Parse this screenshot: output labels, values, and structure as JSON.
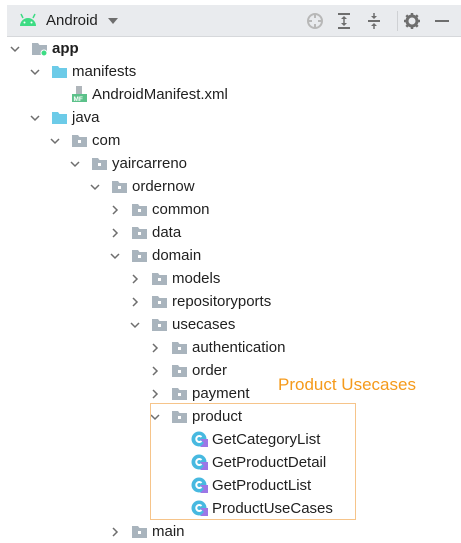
{
  "toolbar": {
    "view_mode": "Android",
    "icons": [
      "android-icon",
      "dropdown-caret-icon",
      "locate-icon",
      "expand-all-icon",
      "collapse-all-icon",
      "settings-gear-icon",
      "hide-minus-icon"
    ]
  },
  "colors": {
    "folder": "#a9b4bd",
    "source_folder": "#6ccbe8",
    "highlight": "#f59a1b",
    "kotlin_class": "#47b9e0",
    "kotlin_badge": "#9c77e6",
    "android_green": "#3ddc84"
  },
  "tree": [
    {
      "label": "app",
      "level": 0,
      "expanded": true,
      "icon": "module-folder-icon",
      "bold": true
    },
    {
      "label": "manifests",
      "level": 1,
      "expanded": true,
      "icon": "source-folder-icon"
    },
    {
      "label": "AndroidManifest.xml",
      "level": 2,
      "expanded": null,
      "icon": "manifest-file-icon"
    },
    {
      "label": "java",
      "level": 1,
      "expanded": true,
      "icon": "source-folder-icon"
    },
    {
      "label": "com",
      "level": 2,
      "expanded": true,
      "icon": "package-icon"
    },
    {
      "label": "yaircarreno",
      "level": 3,
      "expanded": true,
      "icon": "package-icon"
    },
    {
      "label": "ordernow",
      "level": 4,
      "expanded": true,
      "icon": "package-icon"
    },
    {
      "label": "common",
      "level": 5,
      "expanded": false,
      "icon": "package-icon"
    },
    {
      "label": "data",
      "level": 5,
      "expanded": false,
      "icon": "package-icon"
    },
    {
      "label": "domain",
      "level": 5,
      "expanded": true,
      "icon": "package-icon"
    },
    {
      "label": "models",
      "level": 6,
      "expanded": false,
      "icon": "package-icon"
    },
    {
      "label": "repositoryports",
      "level": 6,
      "expanded": false,
      "icon": "package-icon"
    },
    {
      "label": "usecases",
      "level": 6,
      "expanded": true,
      "icon": "package-icon"
    },
    {
      "label": "authentication",
      "level": 7,
      "expanded": false,
      "icon": "package-icon"
    },
    {
      "label": "order",
      "level": 7,
      "expanded": false,
      "icon": "package-icon"
    },
    {
      "label": "payment",
      "level": 7,
      "expanded": false,
      "icon": "package-icon"
    },
    {
      "label": "product",
      "level": 7,
      "expanded": true,
      "icon": "package-icon"
    },
    {
      "label": "GetCategoryList",
      "level": 8,
      "expanded": null,
      "icon": "kotlin-class-icon"
    },
    {
      "label": "GetProductDetail",
      "level": 8,
      "expanded": null,
      "icon": "kotlin-class-icon"
    },
    {
      "label": "GetProductList",
      "level": 8,
      "expanded": null,
      "icon": "kotlin-class-icon"
    },
    {
      "label": "ProductUseCases",
      "level": 8,
      "expanded": null,
      "icon": "kotlin-class-icon"
    },
    {
      "label": "main",
      "level": 5,
      "expanded": false,
      "icon": "package-icon"
    }
  ],
  "annotation": {
    "label": "Product Usecases"
  }
}
